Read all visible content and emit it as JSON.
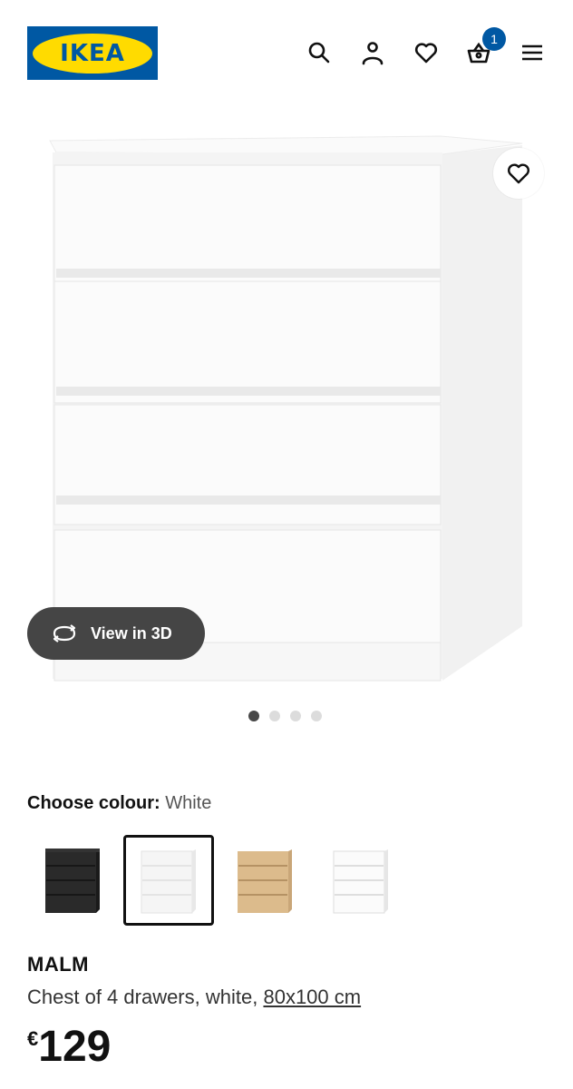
{
  "header": {
    "logo_text": "IKEA",
    "cart_count": "1",
    "icons": [
      "search-icon",
      "account-icon",
      "heart-icon",
      "cart-icon",
      "menu-icon"
    ]
  },
  "gallery": {
    "view3d_label": "View in 3D",
    "slide_count": 4,
    "active_slide": 1
  },
  "colour": {
    "label": "Choose colour:",
    "selected": "White",
    "options": [
      {
        "name": "black",
        "color": "#2a2a2a"
      },
      {
        "name": "white",
        "color": "#f2f2f2"
      },
      {
        "name": "oak",
        "color": "#d9b88a"
      },
      {
        "name": "high-gloss-white",
        "color": "#f7f7f7"
      }
    ],
    "selected_index": 1
  },
  "product": {
    "name": "MALM",
    "description": "Chest of 4 drawers, white,",
    "size_link": "80x100 cm",
    "currency": "€",
    "price": "129"
  },
  "colors": {
    "ikea_blue": "#0058a3",
    "ikea_yellow": "#ffdb00",
    "pill_bg": "#454545"
  }
}
